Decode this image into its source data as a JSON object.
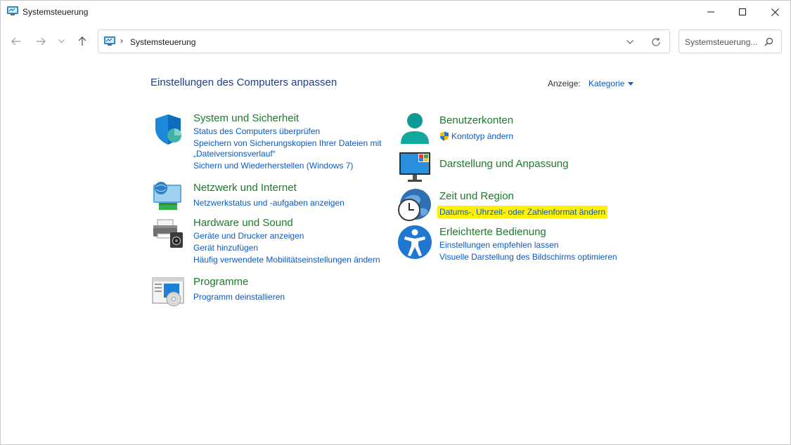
{
  "window": {
    "title": "Systemsteuerung"
  },
  "address_bar": {
    "crumb": "Systemsteuerung",
    "separator": "›"
  },
  "search": {
    "placeholder": "Systemsteuerung..."
  },
  "header": {
    "title": "Einstellungen des Computers anpassen",
    "view_label": "Anzeige:",
    "view_value": "Kategorie"
  },
  "categories": {
    "system": {
      "title": "System und Sicherheit",
      "links": [
        "Status des Computers überprüfen",
        "Speichern von Sicherungskopien Ihrer Dateien mit",
        "„Dateiversionsverlauf“",
        "Sichern und Wiederherstellen (Windows 7)"
      ]
    },
    "network": {
      "title": "Netzwerk und Internet",
      "links": [
        "Netzwerkstatus und -aufgaben anzeigen"
      ]
    },
    "hardware": {
      "title": "Hardware und Sound",
      "links": [
        "Geräte und Drucker anzeigen",
        "Gerät hinzufügen",
        "Häufig verwendete Mobilitätseinstellungen ändern"
      ]
    },
    "programs": {
      "title": "Programme",
      "links": [
        "Programm deinstallieren"
      ]
    },
    "accounts": {
      "title": "Benutzerkonten",
      "links": [
        "Kontotyp ändern"
      ]
    },
    "appearance": {
      "title": "Darstellung und Anpassung",
      "links": []
    },
    "time": {
      "title": "Zeit und Region",
      "links": [
        "Datums-, Uhrzeit- oder Zahlenformat ändern"
      ]
    },
    "ease": {
      "title": "Erleichterte Bedienung",
      "links": [
        "Einstellungen empfehlen lassen",
        "Visuelle Darstellung des Bildschirms optimieren"
      ]
    }
  },
  "colors": {
    "title_green": "#1d7a2c",
    "link_blue": "#0a5bc4",
    "header_blue": "#1e3d8f",
    "highlight_yellow": "#fff200"
  },
  "icons": {
    "app": "control-panel-icon",
    "minimize": "minimize-icon",
    "maximize": "maximize-icon",
    "close": "close-icon",
    "back": "arrow-left-icon",
    "forward": "arrow-right-icon",
    "recent": "chevron-down-icon",
    "up": "arrow-up-icon",
    "refresh": "refresh-icon",
    "search": "search-icon"
  }
}
